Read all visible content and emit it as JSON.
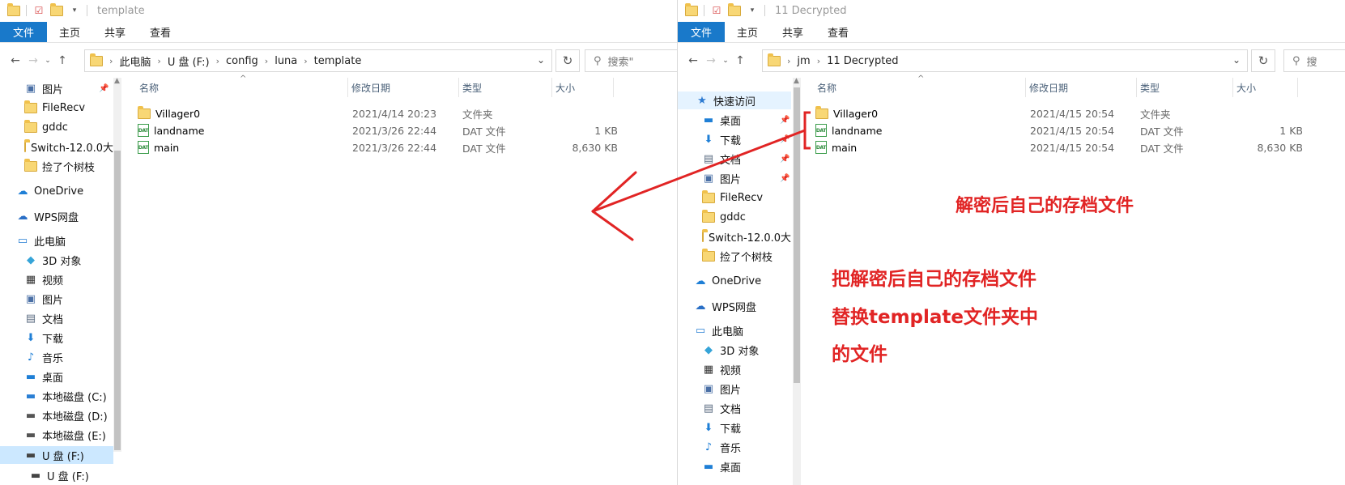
{
  "left": {
    "title": "template",
    "ribbon_tabs": [
      "文件",
      "主页",
      "共享",
      "查看"
    ],
    "breadcrumb": [
      "此电脑",
      "U 盘 (F:)",
      "config",
      "luna",
      "template"
    ],
    "search_placeholder": "搜索\"",
    "nav_items": [
      {
        "label": "图片",
        "icon": "pictures-icon",
        "pinned": true
      },
      {
        "label": "FileRecv",
        "icon": "folder-icon"
      },
      {
        "label": "gddc",
        "icon": "folder-icon"
      },
      {
        "label": "Switch-12.0.0大",
        "icon": "folder-icon"
      },
      {
        "label": "捡了个树枝",
        "icon": "folder-icon"
      },
      {
        "label": "OneDrive",
        "icon": "onedrive-icon"
      },
      {
        "label": "WPS网盘",
        "icon": "cloud-icon"
      },
      {
        "label": "此电脑",
        "icon": "computer-icon"
      },
      {
        "label": "3D 对象",
        "icon": "cube-icon"
      },
      {
        "label": "视频",
        "icon": "video-icon"
      },
      {
        "label": "图片",
        "icon": "pictures-icon"
      },
      {
        "label": "文档",
        "icon": "documents-icon"
      },
      {
        "label": "下载",
        "icon": "download-icon"
      },
      {
        "label": "音乐",
        "icon": "music-icon"
      },
      {
        "label": "桌面",
        "icon": "desktop-icon"
      },
      {
        "label": "本地磁盘 (C:)",
        "icon": "system-drive-icon"
      },
      {
        "label": "本地磁盘 (D:)",
        "icon": "drive-icon"
      },
      {
        "label": "本地磁盘 (E:)",
        "icon": "drive-icon"
      },
      {
        "label": "U 盘 (F:)",
        "icon": "usb-drive-icon",
        "selected": true
      },
      {
        "label": "U 盘 (F:)",
        "icon": "usb-drive-icon"
      }
    ],
    "columns": [
      "名称",
      "修改日期",
      "类型",
      "大小"
    ],
    "files": [
      {
        "name": "Villager0",
        "date": "2021/4/14 20:23",
        "type": "文件夹",
        "size": "",
        "icon": "folder-icon"
      },
      {
        "name": "landname",
        "date": "2021/3/26 22:44",
        "type": "DAT 文件",
        "size": "1 KB",
        "icon": "dat-file-icon"
      },
      {
        "name": "main",
        "date": "2021/3/26 22:44",
        "type": "DAT 文件",
        "size": "8,630 KB",
        "icon": "dat-file-icon"
      }
    ]
  },
  "right": {
    "title": "11 Decrypted",
    "ribbon_tabs": [
      "文件",
      "主页",
      "共享",
      "查看"
    ],
    "breadcrumb": [
      "jm",
      "11 Decrypted"
    ],
    "search_placeholder": "搜",
    "nav_items": [
      {
        "label": "快速访问",
        "icon": "star-icon",
        "highlight": true
      },
      {
        "label": "桌面",
        "icon": "desktop-icon",
        "pinned": true
      },
      {
        "label": "下载",
        "icon": "download-icon",
        "pinned": true
      },
      {
        "label": "文档",
        "icon": "documents-icon",
        "pinned": true
      },
      {
        "label": "图片",
        "icon": "pictures-icon",
        "pinned": true
      },
      {
        "label": "FileRecv",
        "icon": "folder-icon"
      },
      {
        "label": "gddc",
        "icon": "folder-icon"
      },
      {
        "label": "Switch-12.0.0大",
        "icon": "folder-icon"
      },
      {
        "label": "捡了个树枝",
        "icon": "folder-icon"
      },
      {
        "label": "OneDrive",
        "icon": "onedrive-icon"
      },
      {
        "label": "WPS网盘",
        "icon": "cloud-icon"
      },
      {
        "label": "此电脑",
        "icon": "computer-icon"
      },
      {
        "label": "3D 对象",
        "icon": "cube-icon"
      },
      {
        "label": "视频",
        "icon": "video-icon"
      },
      {
        "label": "图片",
        "icon": "pictures-icon"
      },
      {
        "label": "文档",
        "icon": "documents-icon"
      },
      {
        "label": "下载",
        "icon": "download-icon"
      },
      {
        "label": "音乐",
        "icon": "music-icon"
      },
      {
        "label": "桌面",
        "icon": "desktop-icon"
      }
    ],
    "columns": [
      "名称",
      "修改日期",
      "类型",
      "大小"
    ],
    "files": [
      {
        "name": "Villager0",
        "date": "2021/4/15 20:54",
        "type": "文件夹",
        "size": "",
        "icon": "folder-icon"
      },
      {
        "name": "landname",
        "date": "2021/4/15 20:54",
        "type": "DAT 文件",
        "size": "1 KB",
        "icon": "dat-file-icon"
      },
      {
        "name": "main",
        "date": "2021/4/15 20:54",
        "type": "DAT 文件",
        "size": "8,630 KB",
        "icon": "dat-file-icon"
      }
    ]
  },
  "annotations": {
    "label1": "解密后自己的存档文件",
    "label2_lines": [
      "把解密后自己的存档文件",
      "替换template文件夹中",
      "的文件"
    ],
    "color": "#e12424"
  },
  "dat_icon_text": "DAT",
  "colors": {
    "accent": "#1979ca",
    "selection": "#cce8ff",
    "annotation": "#e12424"
  }
}
